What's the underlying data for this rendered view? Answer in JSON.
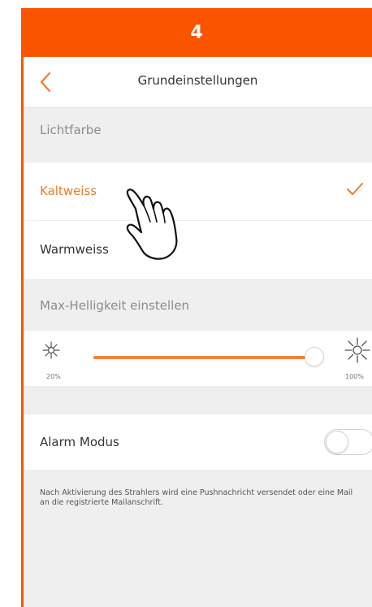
{
  "step_badge": "4",
  "header": {
    "title": "Grundeinstellungen",
    "back_icon": "chevron-left-icon"
  },
  "light_color": {
    "section_label": "Lichtfarbe",
    "options": [
      {
        "label": "Kaltweiss",
        "selected": true
      },
      {
        "label": "Warmweiss",
        "selected": false
      }
    ]
  },
  "brightness": {
    "section_label": "Max-Helligkeit einstellen",
    "min_label": "20%",
    "max_label": "100%",
    "value_fraction": 1.0,
    "min_icon": "sun-small-icon",
    "max_icon": "sun-large-icon"
  },
  "alarm": {
    "label": "Alarm Modus",
    "enabled": false
  },
  "note": "Nach Aktivierung des Strahlers wird eine Pushnachricht versendet oder eine Mail an die registrierte Mailanschrift.",
  "colors": {
    "accent": "#fa5400",
    "selected_text": "#f07a2a",
    "slider_fill": "#f0823a",
    "background": "#efefef"
  }
}
